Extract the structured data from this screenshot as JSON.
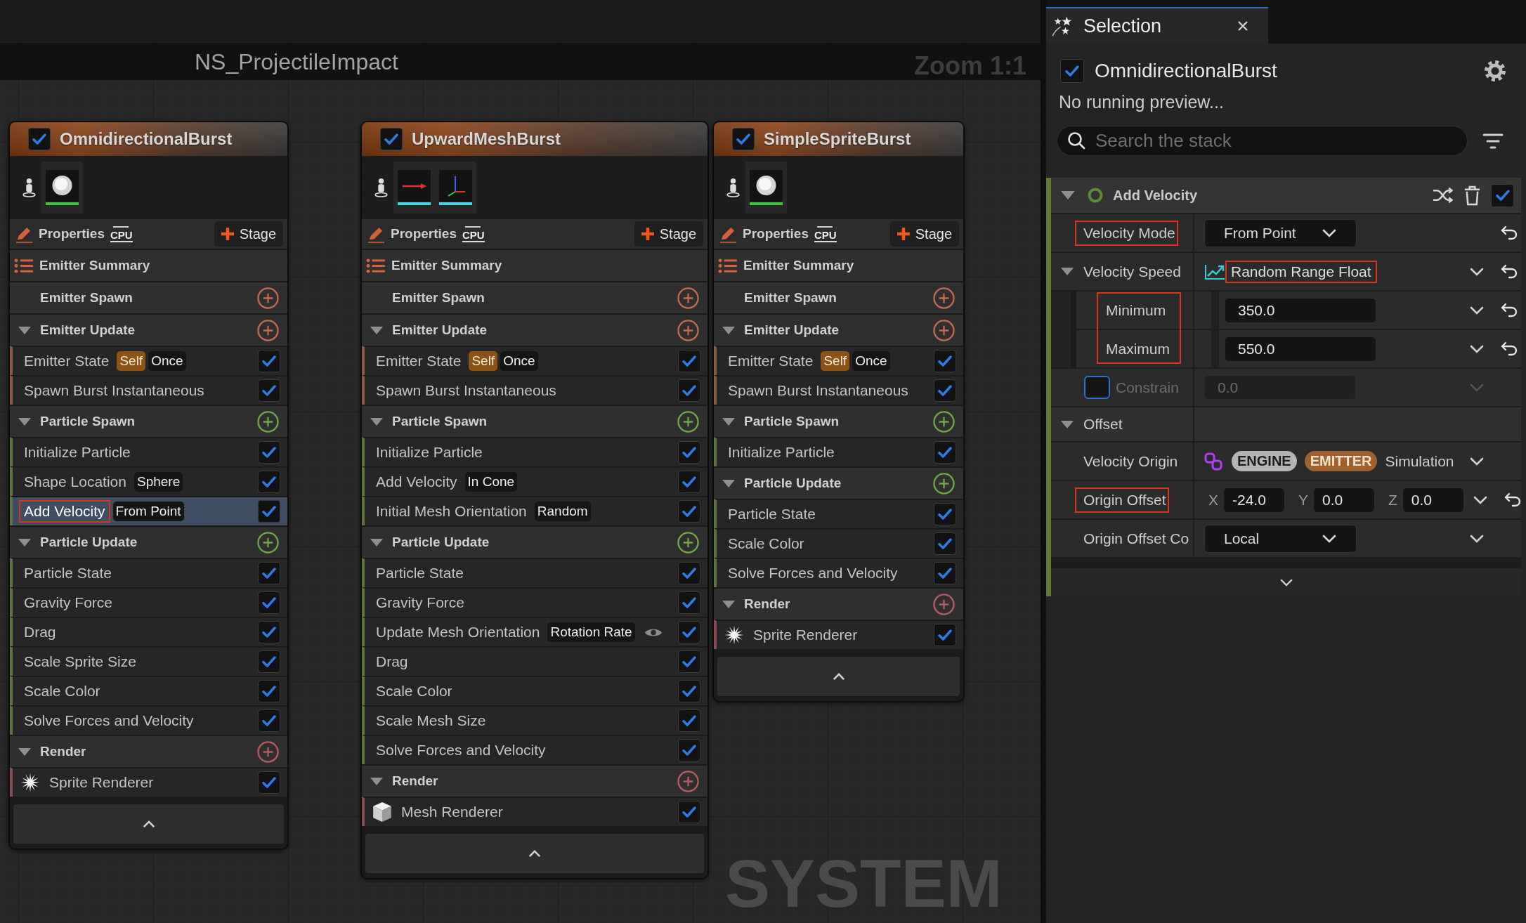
{
  "editor": {
    "asset_title": "NS_ProjectileImpact",
    "zoom_label": "Zoom 1:1",
    "overlay_label": "SYSTEM"
  },
  "nodes": [
    {
      "title": "OmnidirectionalBurst",
      "enabled": true,
      "thumbnails": [
        {
          "kind": "sprite"
        }
      ],
      "properties_label": "Properties",
      "sim_target": "CPU",
      "stage_button": "Stage",
      "summary_label": "Emitter Summary",
      "sections": [
        {
          "title": "Emitter Spawn",
          "kind": "emitter"
        },
        {
          "title": "Emitter Update",
          "kind": "emitter",
          "expanded": true,
          "items": [
            {
              "label": "Emitter State",
              "kind": "module",
              "tags": [
                {
                  "label": "Self",
                  "kind": "self"
                },
                {
                  "label": "Once",
                  "kind": "value"
                }
              ],
              "checked": true,
              "selected": false,
              "highlighted": false
            },
            {
              "label": "Spawn Burst Instantaneous",
              "kind": "module",
              "checked": true,
              "selected": false,
              "highlighted": false
            }
          ]
        },
        {
          "title": "Particle Spawn",
          "kind": "particle",
          "expanded": true,
          "items": [
            {
              "label": "Initialize Particle",
              "kind": "module",
              "checked": true,
              "selected": false,
              "highlighted": false
            },
            {
              "label": "Shape Location",
              "kind": "module",
              "tags": [
                {
                  "label": "Sphere",
                  "kind": "value"
                }
              ],
              "checked": true,
              "selected": false,
              "highlighted": false
            },
            {
              "label": "Add Velocity",
              "kind": "module",
              "tags": [
                {
                  "label": "From Point",
                  "kind": "value"
                }
              ],
              "checked": true,
              "selected": true,
              "highlighted": true
            }
          ]
        },
        {
          "title": "Particle Update",
          "kind": "particle",
          "expanded": true,
          "items": [
            {
              "label": "Particle State",
              "kind": "module",
              "checked": true,
              "selected": false,
              "highlighted": false
            },
            {
              "label": "Gravity Force",
              "kind": "module",
              "checked": true,
              "selected": false,
              "highlighted": false
            },
            {
              "label": "Drag",
              "kind": "module",
              "checked": true,
              "selected": false,
              "highlighted": false
            },
            {
              "label": "Scale Sprite Size",
              "kind": "module",
              "checked": true,
              "selected": false,
              "highlighted": false
            },
            {
              "label": "Scale Color",
              "kind": "module",
              "checked": true,
              "selected": false,
              "highlighted": false
            },
            {
              "label": "Solve Forces and Velocity",
              "kind": "module",
              "checked": true,
              "selected": false,
              "highlighted": false
            }
          ]
        },
        {
          "title": "Render",
          "kind": "render",
          "expanded": true,
          "items": [
            {
              "label": "Sprite Renderer",
              "kind": "sprite",
              "checked": true,
              "selected": false,
              "highlighted": false
            }
          ]
        }
      ]
    },
    {
      "title": "UpwardMeshBurst",
      "enabled": true,
      "thumbnails": [
        {
          "kind": "mesh_arrow"
        },
        {
          "kind": "mesh_axes"
        }
      ],
      "properties_label": "Properties",
      "sim_target": "CPU",
      "stage_button": "Stage",
      "summary_label": "Emitter Summary",
      "sections": [
        {
          "title": "Emitter Spawn",
          "kind": "emitter"
        },
        {
          "title": "Emitter Update",
          "kind": "emitter",
          "expanded": true,
          "items": [
            {
              "label": "Emitter State",
              "kind": "module",
              "tags": [
                {
                  "label": "Self",
                  "kind": "self"
                },
                {
                  "label": "Once",
                  "kind": "value"
                }
              ],
              "checked": true,
              "selected": false,
              "highlighted": false
            },
            {
              "label": "Spawn Burst Instantaneous",
              "kind": "module",
              "checked": true,
              "selected": false,
              "highlighted": false
            }
          ]
        },
        {
          "title": "Particle Spawn",
          "kind": "particle",
          "expanded": true,
          "items": [
            {
              "label": "Initialize Particle",
              "kind": "module",
              "checked": true,
              "selected": false,
              "highlighted": false
            },
            {
              "label": "Add Velocity",
              "kind": "module",
              "tags": [
                {
                  "label": "In Cone",
                  "kind": "value"
                }
              ],
              "checked": true,
              "selected": false,
              "highlighted": false
            },
            {
              "label": "Initial Mesh Orientation",
              "kind": "module",
              "tags": [
                {
                  "label": "Random",
                  "kind": "value"
                }
              ],
              "checked": true,
              "selected": false,
              "highlighted": false
            }
          ]
        },
        {
          "title": "Particle Update",
          "kind": "particle",
          "expanded": true,
          "items": [
            {
              "label": "Particle State",
              "kind": "module",
              "checked": true,
              "selected": false,
              "highlighted": false
            },
            {
              "label": "Gravity Force",
              "kind": "module",
              "checked": true,
              "selected": false,
              "highlighted": false
            },
            {
              "label": "Update Mesh Orientation",
              "kind": "visualized",
              "tags": [
                {
                  "label": "Rotation Rate",
                  "kind": "value"
                }
              ],
              "checked": true,
              "selected": false,
              "highlighted": false
            },
            {
              "label": "Drag",
              "kind": "module",
              "checked": true,
              "selected": false,
              "highlighted": false
            },
            {
              "label": "Scale Color",
              "kind": "module",
              "checked": true,
              "selected": false,
              "highlighted": false
            },
            {
              "label": "Scale Mesh Size",
              "kind": "module",
              "checked": true,
              "selected": false,
              "highlighted": false
            },
            {
              "label": "Solve Forces and Velocity",
              "kind": "module",
              "checked": true,
              "selected": false,
              "highlighted": false
            }
          ]
        },
        {
          "title": "Render",
          "kind": "render",
          "expanded": true,
          "items": [
            {
              "label": "Mesh Renderer",
              "kind": "mesh",
              "checked": true,
              "selected": false,
              "highlighted": false
            }
          ]
        }
      ]
    },
    {
      "title": "SimpleSpriteBurst",
      "enabled": true,
      "thumbnails": [
        {
          "kind": "sprite"
        }
      ],
      "properties_label": "Properties",
      "sim_target": "CPU",
      "stage_button": "Stage",
      "summary_label": "Emitter Summary",
      "sections": [
        {
          "title": "Emitter Spawn",
          "kind": "emitter"
        },
        {
          "title": "Emitter Update",
          "kind": "emitter",
          "expanded": true,
          "items": [
            {
              "label": "Emitter State",
              "kind": "module",
              "tags": [
                {
                  "label": "Self",
                  "kind": "self"
                },
                {
                  "label": "Once",
                  "kind": "value"
                }
              ],
              "checked": true,
              "selected": false,
              "highlighted": false
            },
            {
              "label": "Spawn Burst Instantaneous",
              "kind": "module",
              "checked": true,
              "selected": false,
              "highlighted": false
            }
          ]
        },
        {
          "title": "Particle Spawn",
          "kind": "particle",
          "expanded": true,
          "items": [
            {
              "label": "Initialize Particle",
              "kind": "module",
              "checked": true,
              "selected": false,
              "highlighted": false
            }
          ]
        },
        {
          "title": "Particle Update",
          "kind": "particle",
          "expanded": true,
          "items": [
            {
              "label": "Particle State",
              "kind": "module",
              "checked": true,
              "selected": false,
              "highlighted": false
            },
            {
              "label": "Scale Color",
              "kind": "module",
              "checked": true,
              "selected": false,
              "highlighted": false
            },
            {
              "label": "Solve Forces and Velocity",
              "kind": "module",
              "checked": true,
              "selected": false,
              "highlighted": false
            }
          ]
        },
        {
          "title": "Render",
          "kind": "render",
          "expanded": true,
          "items": [
            {
              "label": "Sprite Renderer",
              "kind": "sprite",
              "checked": true,
              "selected": false,
              "highlighted": false
            }
          ]
        }
      ]
    }
  ],
  "selection_panel": {
    "tab": {
      "title": "Selection",
      "selected": true
    },
    "emitter": {
      "name": "OmnidirectionalBurst",
      "enabled": true
    },
    "status": "No running preview...",
    "search": {
      "placeholder": "Search the stack"
    },
    "module": {
      "title": "Add Velocity",
      "expanded": true,
      "enabled": true,
      "params": [
        {
          "kind": "dropdown",
          "label": "Velocity Mode",
          "value": "From Point",
          "highlighted": true,
          "disabled": false,
          "options_menu": false,
          "resettable": true
        },
        {
          "kind": "dynamic",
          "label": "Velocity Speed",
          "value": "Random Range Float",
          "expanded": true,
          "highlighted": false,
          "value_highlighted": true,
          "disabled": false,
          "options_menu": true,
          "resettable": true,
          "children_highlighted": true,
          "children": [
            {
              "label": "Minimum",
              "value": "350.0",
              "options_menu": true,
              "resettable": true
            },
            {
              "label": "Maximum",
              "value": "550.0",
              "options_menu": true,
              "resettable": true
            }
          ]
        },
        {
          "kind": "toggle",
          "label": "Constrain",
          "value": "0.0",
          "checked": false,
          "highlighted": false,
          "disabled": true,
          "options_menu": true,
          "resettable": false
        },
        {
          "kind": "category",
          "label": "Offset",
          "expanded": true,
          "highlighted": false,
          "disabled": false,
          "options_menu": false,
          "resettable": false
        },
        {
          "kind": "namespace",
          "label": "Velocity Origin",
          "tags": [
            {
              "label": "ENGINE",
              "kind": "engine"
            },
            {
              "label": "EMITTER",
              "kind": "emitter"
            }
          ],
          "value": "Simulation",
          "highlighted": false,
          "disabled": false,
          "options_menu": true,
          "resettable": false
        },
        {
          "kind": "vector",
          "label": "Origin Offset",
          "components": [
            {
              "axis": "X",
              "value": "-24.0"
            },
            {
              "axis": "Y",
              "value": "0.0"
            },
            {
              "axis": "Z",
              "value": "0.0"
            }
          ],
          "highlighted": true,
          "disabled": false,
          "options_menu": true,
          "resettable": true
        },
        {
          "kind": "dropdown",
          "label": "Origin Offset Co",
          "value": "Local",
          "highlighted": false,
          "disabled": false,
          "options_menu": true,
          "resettable": false
        }
      ]
    }
  }
}
